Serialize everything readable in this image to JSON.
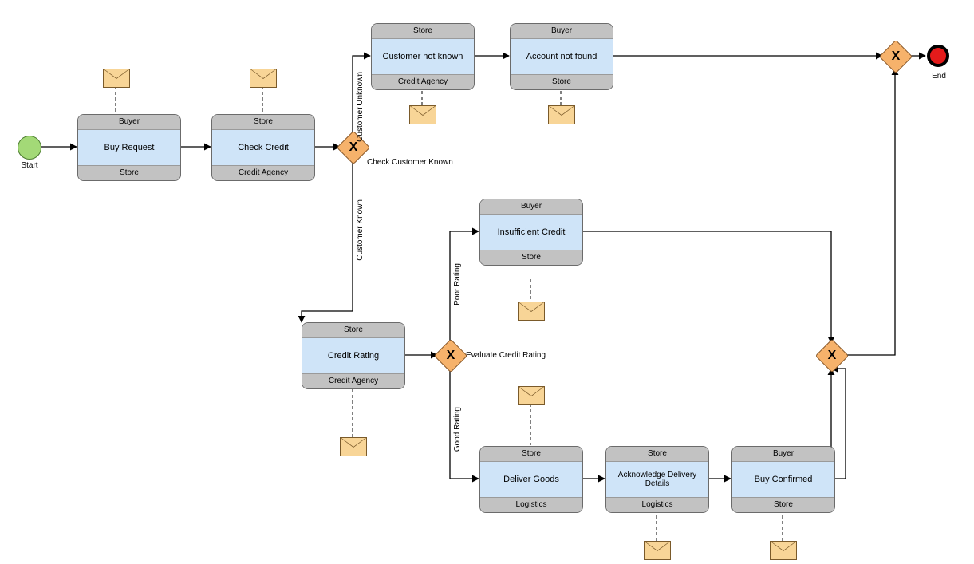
{
  "events": {
    "start": "Start",
    "end": "End"
  },
  "gateways": {
    "g1": {
      "label": "Check Customer Known",
      "paths": {
        "unknown": "Customer Unknown",
        "known": "Customer Known"
      }
    },
    "g2": {
      "label": "Evaluate Credit Rating",
      "paths": {
        "poor": "Poor Rating",
        "good": "Good Rating"
      }
    }
  },
  "tasks": {
    "buyRequest": {
      "top": "Buyer",
      "name": "Buy Request",
      "bottom": "Store"
    },
    "checkCredit": {
      "top": "Store",
      "name": "Check Credit",
      "bottom": "Credit Agency"
    },
    "custNotKnown": {
      "top": "Store",
      "name": "Customer not known",
      "bottom": "Credit Agency"
    },
    "acctNotFound": {
      "top": "Buyer",
      "name": "Account not found",
      "bottom": "Store"
    },
    "creditRating": {
      "top": "Store",
      "name": "Credit Rating",
      "bottom": "Credit Agency"
    },
    "insufCredit": {
      "top": "Buyer",
      "name": "Insufficient Credit",
      "bottom": "Store"
    },
    "deliverGoods": {
      "top": "Store",
      "name": "Deliver Goods",
      "bottom": "Logistics"
    },
    "ackDelivery": {
      "top": "Store",
      "name": "Acknowledge Delivery Details",
      "bottom": "Logistics"
    },
    "buyConfirmed": {
      "top": "Buyer",
      "name": "Buy Confirmed",
      "bottom": "Store"
    }
  }
}
